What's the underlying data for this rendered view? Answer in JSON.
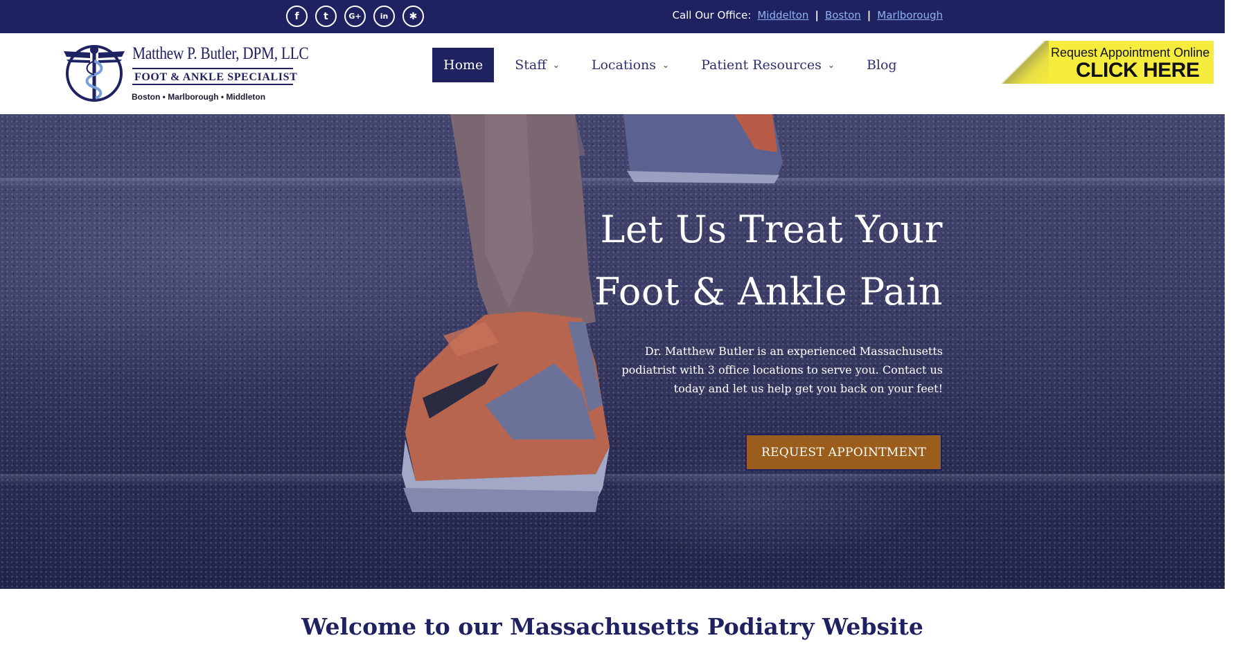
{
  "colors": {
    "navy": "#1f2260",
    "link": "#8fb1f0",
    "button_brown": "#9a5d1c",
    "banner_yellow": "#f6ec3d"
  },
  "topbar": {
    "socials": [
      {
        "icon": "facebook-icon",
        "glyph": "f"
      },
      {
        "icon": "twitter-icon",
        "glyph": "t"
      },
      {
        "icon": "google-plus-icon",
        "glyph": "G+"
      },
      {
        "icon": "linkedin-icon",
        "glyph": "in"
      },
      {
        "icon": "yelp-icon",
        "glyph": "✱"
      }
    ],
    "call_label": "Call Our Office:",
    "offices": [
      "Middelton",
      "Boston",
      "Marlborough"
    ],
    "separator": "|"
  },
  "logo": {
    "name": "Matthew P. Butler, DPM, LLC",
    "specialty": "FOOT & ANKLE SPECIALIST",
    "towns": "Boston • Marlborough • Middleton"
  },
  "nav": {
    "items": [
      {
        "label": "Home",
        "active": true,
        "dropdown": false
      },
      {
        "label": "Staff",
        "active": false,
        "dropdown": true
      },
      {
        "label": "Locations",
        "active": false,
        "dropdown": true
      },
      {
        "label": "Patient Resources",
        "active": false,
        "dropdown": true
      },
      {
        "label": "Blog",
        "active": false,
        "dropdown": false
      }
    ]
  },
  "appointment_banner": {
    "line1": "Request Appointment Online",
    "line2": "CLICK HERE"
  },
  "hero": {
    "title": "Let Us Treat Your\nFoot & Ankle Pain",
    "text": "Dr. Matthew Butler is an experienced Massachusetts podiatrist with 3 office locations to serve you. Contact us today and let us help get you back on your feet!",
    "button": "REQUEST APPOINTMENT"
  },
  "welcome": {
    "heading": "Welcome to our Massachusetts Podiatry Website"
  }
}
